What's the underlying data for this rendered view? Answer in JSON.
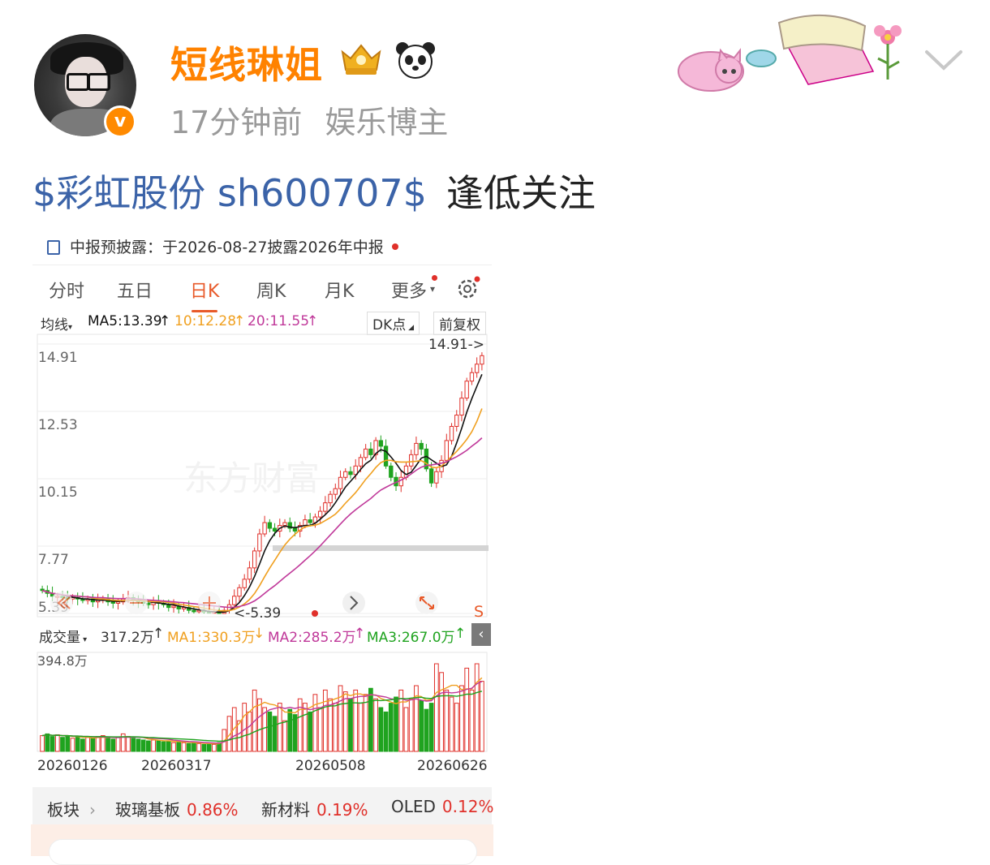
{
  "post": {
    "username": "短线琳姐",
    "time_ago": "17分钟前",
    "category": "娱乐博主",
    "stock_tag": "$彩虹股份 sh600707$",
    "text": "逢低关注"
  },
  "icons": {
    "verified": "verified-v-badge-icon",
    "crown": "crown-badge-icon",
    "panda": "panda-icon",
    "decoration": "cat-and-flower-decoration",
    "dropdown": "chevron-down-icon"
  },
  "quote": {
    "notice": "中报预披露：于2026-08-27披露2026年中报",
    "tabs": [
      "分时",
      "五日",
      "日K",
      "周K",
      "月K",
      "更多"
    ],
    "active_tab": "日K",
    "ma_selector": "均线",
    "ma5": "MA5:13.39",
    "ma10": "10:12.28",
    "ma20": "20:11.55",
    "dk_button": "DK点",
    "adjust_button": "前复权",
    "price_labels": [
      "14.91",
      "12.53",
      "10.15",
      "7.77",
      "5.39"
    ],
    "high_marker": "14.91->",
    "low_marker": "<-5.39",
    "s_marker": "S",
    "watermark": "东方财富",
    "volume_selector": "成交量",
    "volume_value": "317.2万",
    "vma1": "MA1:330.3万",
    "vma2": "MA2:285.2万",
    "vma3": "MA3:267.0万",
    "volume_max": "394.8万",
    "dates": [
      "20260126",
      "20260317",
      "20260508",
      "20260626"
    ],
    "sector_label": "板块",
    "sectors": [
      {
        "name": "玻璃基板",
        "pct": "0.86%"
      },
      {
        "name": "新材料",
        "pct": "0.19%"
      },
      {
        "name": "OLED",
        "pct": "0.12%"
      }
    ]
  },
  "colors": {
    "username": "#ff8200",
    "stock_link": "#3b63a8",
    "up": "#e0302a",
    "down": "#1fa31f",
    "ma5": "#111111",
    "ma10": "#f0a020",
    "ma20": "#c0399a"
  },
  "chart_data": {
    "type": "candlestick",
    "ylim": [
      5.39,
      14.91
    ],
    "y_ticks": [
      14.91,
      12.53,
      10.15,
      7.77,
      5.39
    ],
    "x_ticks": [
      "20260126",
      "20260317",
      "20260508",
      "20260626"
    ],
    "close_series": [
      6.2,
      6.1,
      6.0,
      6.0,
      5.95,
      5.9,
      5.95,
      5.9,
      5.85,
      5.9,
      5.8,
      5.85,
      5.9,
      5.8,
      5.75,
      5.8,
      5.9,
      5.95,
      5.85,
      5.8,
      5.75,
      5.7,
      5.8,
      5.75,
      5.7,
      5.6,
      5.65,
      5.55,
      5.6,
      5.5,
      5.45,
      5.5,
      5.45,
      5.4,
      5.45,
      5.39,
      5.5,
      5.7,
      6.0,
      6.3,
      6.6,
      7.0,
      7.6,
      8.2,
      8.6,
      8.4,
      8.3,
      8.5,
      8.6,
      8.4,
      8.3,
      8.5,
      8.7,
      8.6,
      8.8,
      9.0,
      9.3,
      9.6,
      9.8,
      10.2,
      10.4,
      10.3,
      10.6,
      10.9,
      11.2,
      11.0,
      11.5,
      11.3,
      10.6,
      10.2,
      9.9,
      10.2,
      10.6,
      11.0,
      11.4,
      11.2,
      10.5,
      10.0,
      10.4,
      10.8,
      11.5,
      12.0,
      12.4,
      13.0,
      13.6,
      13.9,
      14.2,
      14.5
    ],
    "volume_max": 3948000,
    "volume_levels": [
      0.18,
      0.2,
      0.17,
      0.19,
      0.16,
      0.18,
      0.15,
      0.17,
      0.14,
      0.16,
      0.15,
      0.17,
      0.18,
      0.15,
      0.14,
      0.16,
      0.2,
      0.17,
      0.15,
      0.14,
      0.13,
      0.12,
      0.13,
      0.12,
      0.11,
      0.12,
      0.1,
      0.11,
      0.1,
      0.09,
      0.1,
      0.09,
      0.08,
      0.09,
      0.08,
      0.1,
      0.25,
      0.4,
      0.5,
      0.35,
      0.55,
      0.45,
      0.7,
      0.6,
      0.5,
      0.45,
      0.4,
      0.55,
      0.35,
      0.48,
      0.42,
      0.6,
      0.55,
      0.45,
      0.65,
      0.5,
      0.7,
      0.6,
      0.55,
      0.75,
      0.68,
      0.6,
      0.7,
      0.55,
      0.65,
      0.72,
      0.6,
      0.5,
      0.45,
      0.55,
      0.62,
      0.7,
      0.5,
      0.6,
      0.75,
      0.58,
      0.48,
      0.55,
      1.0,
      0.9,
      0.7,
      0.62,
      0.55,
      0.75,
      0.95,
      0.7,
      1.0,
      0.8
    ]
  }
}
